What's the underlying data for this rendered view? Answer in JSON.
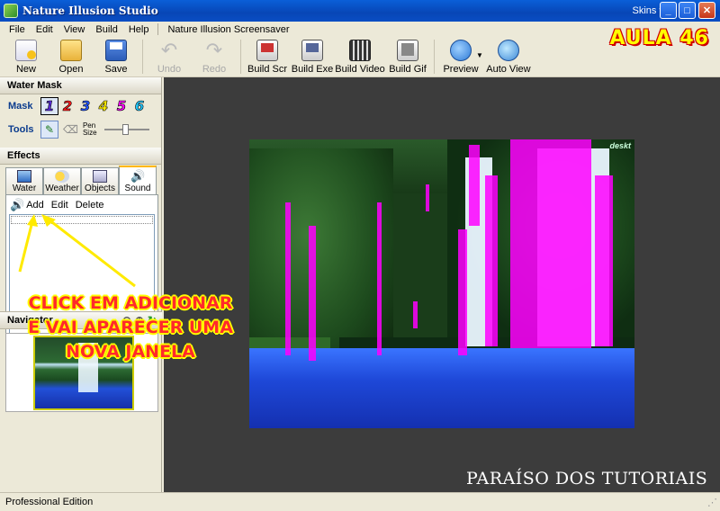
{
  "window": {
    "title": "Nature Illusion Studio",
    "skins_label": "Skins",
    "minimize": "_",
    "maximize": "□",
    "close": "✕"
  },
  "menu": {
    "items": [
      "File",
      "Edit",
      "View",
      "Build",
      "Help"
    ],
    "extra": "Nature Illusion Screensaver"
  },
  "toolbar": {
    "buttons": [
      {
        "label": "New",
        "icon": "new-file-icon"
      },
      {
        "label": "Open",
        "icon": "open-folder-icon"
      },
      {
        "label": "Save",
        "icon": "save-disk-icon"
      },
      {
        "label": "Undo",
        "icon": "undo-arrow-icon",
        "disabled": true
      },
      {
        "label": "Redo",
        "icon": "redo-arrow-icon",
        "disabled": true
      },
      {
        "label": "Build Scr",
        "icon": "build-scr-icon"
      },
      {
        "label": "Build Exe",
        "icon": "build-exe-icon"
      },
      {
        "label": "Build Video",
        "icon": "build-video-icon"
      },
      {
        "label": "Build Gif",
        "icon": "build-gif-icon"
      },
      {
        "label": "Preview",
        "icon": "preview-icon"
      },
      {
        "label": "Auto View",
        "icon": "auto-view-icon"
      }
    ]
  },
  "overlay": {
    "aula": "AULA 46",
    "callout_line1": "CLICK EM ADICIONAR",
    "callout_line2": "E VAI APARECER UMA",
    "callout_line3": "NOVA JANELA",
    "watermark": "PARAÍSO DOS TUTORIAIS",
    "photo_tag": "deskt"
  },
  "water_mask": {
    "title": "Water Mask",
    "mask_label": "Mask",
    "masks": [
      "1",
      "2",
      "3",
      "4",
      "5",
      "6"
    ],
    "mask_colors": [
      "#5a2bd8",
      "#ff1a1a",
      "#2255ff",
      "#ffee00",
      "#ff00ff",
      "#20c8ff"
    ],
    "tools_label": "Tools",
    "pen_size_label_1": "Pen",
    "pen_size_label_2": "Size"
  },
  "effects": {
    "title": "Effects",
    "tabs": [
      "Water",
      "Weather",
      "Objects",
      "Sound"
    ],
    "active_tab": "Sound",
    "actions": {
      "add": "Add",
      "edit": "Edit",
      "delete": "Delete"
    }
  },
  "navigator": {
    "title": "Navigator"
  },
  "status": {
    "edition": "Professional Edition"
  },
  "colors": {
    "accent_pink": "#ff00ff",
    "callout_red": "#ff2a2a",
    "callout_yellow": "#ffff00",
    "canvas_bg": "#3c3c3c"
  }
}
